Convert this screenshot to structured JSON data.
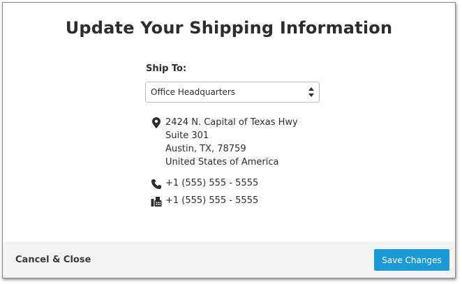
{
  "dialog": {
    "title": "Update Your Shipping Information"
  },
  "ship_to": {
    "label": "Ship To:",
    "selected": "Office Headquarters"
  },
  "address": {
    "line1": "2424 N. Capital of Texas Hwy",
    "line2": "Suite 301",
    "line3": "Austin, TX, 78759",
    "line4": "United States of America"
  },
  "contact": {
    "phone": "+1 (555) 555 - 5555",
    "fax": "+1 (555) 555 - 5555"
  },
  "footer": {
    "cancel_label": "Cancel & Close",
    "save_label": "Save Changes"
  },
  "colors": {
    "accent": "#1b9ad6",
    "text": "#2d2d2d",
    "footer_bg": "#f4f4f4"
  },
  "icons": {
    "address": "map-pin-icon",
    "phone": "phone-icon",
    "fax": "fax-icon",
    "select": "up-down-arrows-icon"
  }
}
